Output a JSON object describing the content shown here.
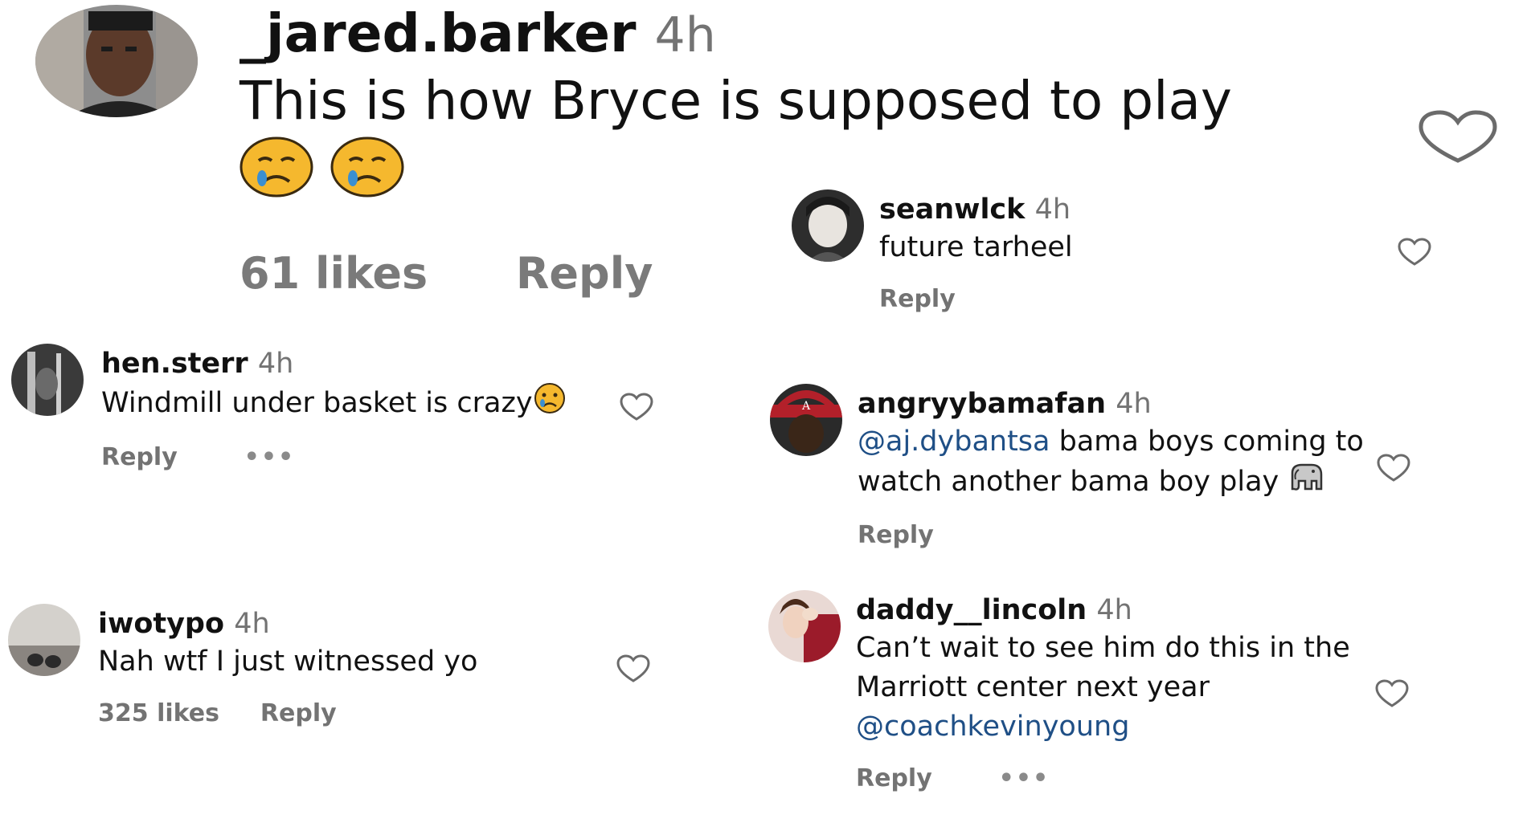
{
  "comments": {
    "jared": {
      "username": "_jared.barker",
      "time": "4h",
      "text": "This is how Bryce is supposed to play",
      "emojis": [
        "crying-face-emoji",
        "crying-face-emoji"
      ],
      "likes": "61 likes",
      "reply": "Reply"
    },
    "seanwlck": {
      "username": "seanwlck",
      "time": "4h",
      "text": "future tarheel",
      "reply": "Reply"
    },
    "hensterr": {
      "username": "hen.sterr",
      "time": "4h",
      "text": "Windmill under basket is crazy",
      "emoji": "sad-face-emoji",
      "reply": "Reply",
      "more": "•••"
    },
    "angry": {
      "username": "angryybamafan",
      "time": "4h",
      "mention": "@aj.dybantsa",
      "text": "bama boys coming to watch another bama boy play",
      "emoji": "elephant-emoji",
      "reply": "Reply"
    },
    "iwotypo": {
      "username": "iwotypo",
      "time": "4h",
      "text": "Nah wtf I just witnessed yo",
      "likes": "325 likes",
      "reply": "Reply"
    },
    "daddy": {
      "username": "daddy__lincoln",
      "time": "4h",
      "text": "Can’t wait to see him do this in the Marriott center next year",
      "mention": "@coachkevinyoung",
      "reply": "Reply",
      "more": "•••"
    }
  },
  "colors": {
    "text": "#111111",
    "muted": "#737373",
    "mention": "#1f4f86",
    "heart_outline": "#6b6b6b"
  }
}
